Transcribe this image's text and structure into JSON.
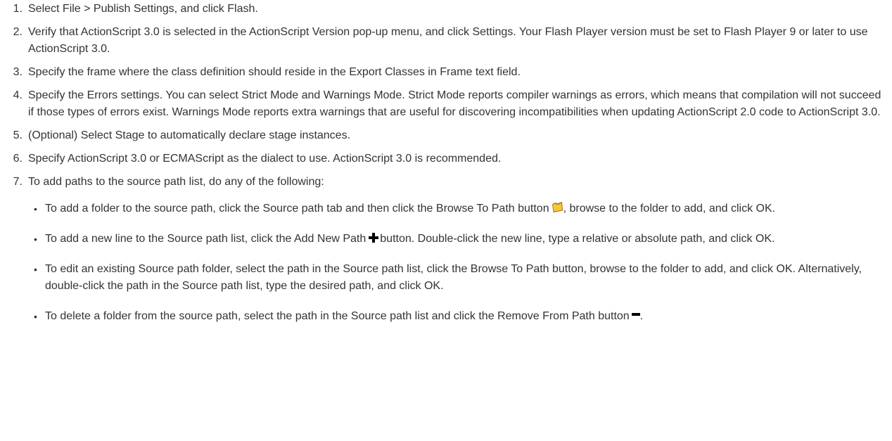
{
  "steps": [
    {
      "num": "1.",
      "text": "Select File > Publish Settings, and click Flash."
    },
    {
      "num": "2.",
      "text": "Verify that ActionScript 3.0 is selected in the ActionScript Version pop-up menu, and click Settings. Your Flash Player version must be set to Flash Player 9 or later to use ActionScript 3.0."
    },
    {
      "num": "3.",
      "text": "Specify the frame where the class definition should reside in the Export Classes in Frame text field."
    },
    {
      "num": "4.",
      "text": "Specify the Errors settings. You can select Strict Mode and Warnings Mode. Strict Mode reports compiler warnings as errors, which means that compilation will not succeed if those types of errors exist. Warnings Mode reports extra warnings that are useful for discovering incompatibilities when updating ActionScript 2.0 code to ActionScript 3.0."
    },
    {
      "num": "5.",
      "text": "(Optional) Select Stage to automatically declare stage instances."
    },
    {
      "num": "6.",
      "text": "Specify ActionScript 3.0 or ECMAScript as the dialect to use. ActionScript 3.0 is recommended."
    },
    {
      "num": "7.",
      "text": "To add paths to the source path list, do any of the following:"
    }
  ],
  "subitems": {
    "browse": {
      "before": "To add a folder to the source path, click the Source path tab and then click the Browse To Path button",
      "after": ", browse to the folder to add, and click OK.",
      "icon": "folder-icon"
    },
    "add": {
      "before": "To add a new line to the Source path list, click the Add New Path",
      "after": "button. Double-click the new line, type a relative or absolute path, and click OK.",
      "icon": "plus-icon"
    },
    "edit": {
      "text": "To edit an existing Source path folder, select the path in the Source path list, click the Browse To Path button, browse to the folder to add, and click OK. Alternatively, double-click the path in the Source path list, type the desired path, and click OK."
    },
    "delete": {
      "before": "To delete a folder from the source path, select the path in the Source path list and click the Remove From Path button",
      "after": ".",
      "icon": "minus-icon"
    }
  },
  "colors": {
    "text": "#333333",
    "folder_fill": "#f6c73b",
    "folder_outline": "#9c6a12",
    "icon_dark": "#000000"
  }
}
